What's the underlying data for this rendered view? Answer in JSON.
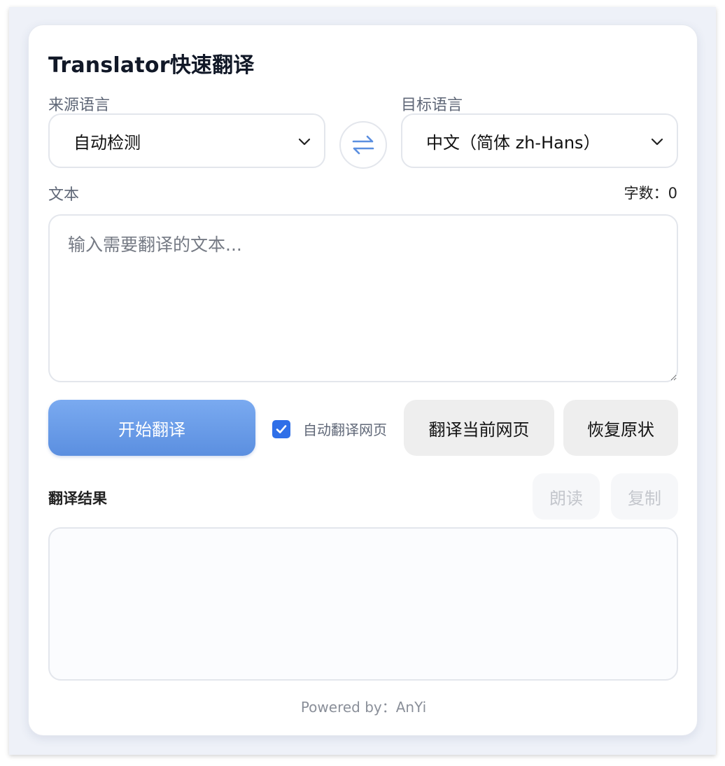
{
  "app": {
    "title": "Translator快速翻译"
  },
  "source": {
    "label": "来源语言",
    "selected": "自动检测"
  },
  "target": {
    "label": "目标语言",
    "selected": "中文（简体 zh-Hans）"
  },
  "swap": {
    "icon": "swap-arrows-icon"
  },
  "text": {
    "label": "文本",
    "count_label": "字数：",
    "count_value": "0",
    "placeholder": "输入需要翻译的文本...",
    "value": ""
  },
  "actions": {
    "translate_label": "开始翻译",
    "auto_translate_label": "自动翻译网页",
    "auto_translate_checked": true,
    "translate_page_label": "翻译当前网页",
    "restore_label": "恢复原状"
  },
  "result": {
    "label": "翻译结果",
    "read_label": "朗读",
    "copy_label": "复制",
    "value": ""
  },
  "footer": {
    "text": "Powered by：AnYi"
  },
  "colors": {
    "primary": "#5b8fe0",
    "checkbox": "#2f6fe8",
    "background": "#eef1f8"
  }
}
